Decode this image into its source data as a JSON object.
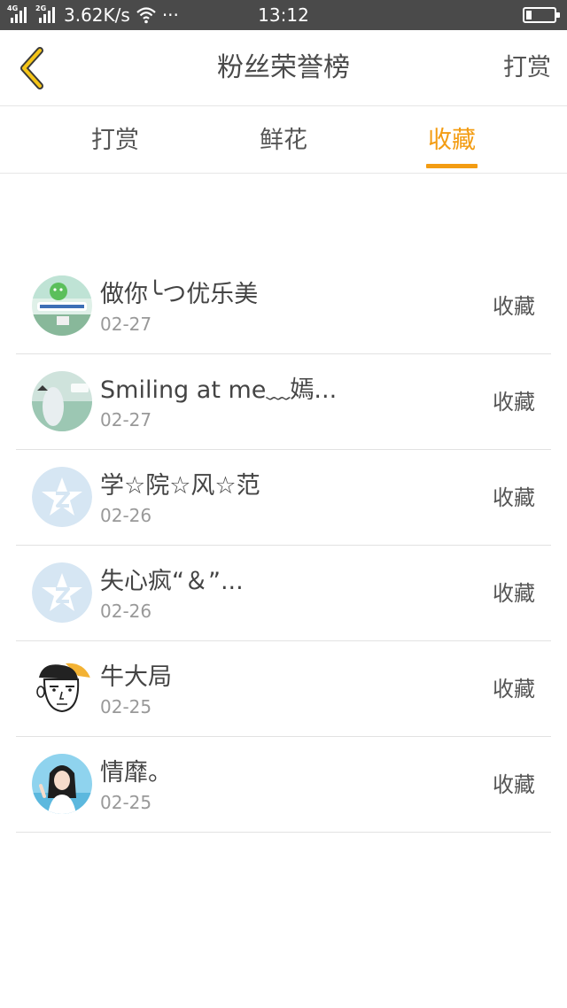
{
  "status_bar": {
    "net1": "4G",
    "net2": "2G",
    "speed": "3.62K/s",
    "dots": "···",
    "time": "13:12",
    "battery_level": 0.2
  },
  "header": {
    "title": "粉丝荣誉榜",
    "right_action": "打赏"
  },
  "tabs": [
    {
      "label": "打赏",
      "active": false
    },
    {
      "label": "鲜花",
      "active": false
    },
    {
      "label": "收藏",
      "active": true
    }
  ],
  "accent_color": "#f39c12",
  "list": [
    {
      "name": "做你╰つ优乐美",
      "date": "02-27",
      "action": "收藏",
      "avatar": "wechat-promo-avatar"
    },
    {
      "name": "Smiling at me﹏嫣...",
      "date": "02-27",
      "action": "收藏",
      "avatar": "photo-avatar"
    },
    {
      "name": "学☆院☆风☆范",
      "date": "02-26",
      "action": "收藏",
      "avatar": "default-qzone-avatar"
    },
    {
      "name": "失心疯“＆”...",
      "date": "02-26",
      "action": "收藏",
      "avatar": "default-qzone-avatar"
    },
    {
      "name": "牛大局",
      "date": "02-25",
      "action": "收藏",
      "avatar": "cartoon-face-avatar"
    },
    {
      "name": "情靡。",
      "date": "02-25",
      "action": "收藏",
      "avatar": "girl-photo-avatar"
    }
  ]
}
